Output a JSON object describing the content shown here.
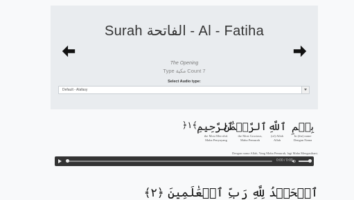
{
  "header": {
    "title": "Surah الفاتحة - Al - Fatiha",
    "subtitle": "The Opening",
    "meta": "Type مكية Count 7",
    "select_label": "Select Audio type:",
    "audio_select_value": "Default - Alafasy"
  },
  "verse1": {
    "words": [
      {
        "arabic": "بِسۡمِ",
        "en": "In (the) name",
        "id": "Dengan Nama"
      },
      {
        "arabic": "ٱللَّهِ",
        "en": "(of) Allah",
        "id": "Allah"
      },
      {
        "arabic": "ٱلرَّحۡمَٰنِ",
        "en": "the Most Gracious,",
        "id": "Maha Pemurah"
      },
      {
        "arabic": "ٱلرَّحِيمِ",
        "en": "the Most Merciful.",
        "id": "Maha Penyayang"
      }
    ],
    "ayah_marker": "﴿١﴾",
    "translation": "Dengan nama Allah, Yang Maha Pemurah, lagi Maha Mengasihani."
  },
  "audio": {
    "time": "0:00 / 0:00"
  },
  "verse2": {
    "arabic": "ٱلۡحَمۡدُ لِلَّهِ رَبِّ ٱلۡعَٰلَمِينَ ﴿٢﴾"
  }
}
